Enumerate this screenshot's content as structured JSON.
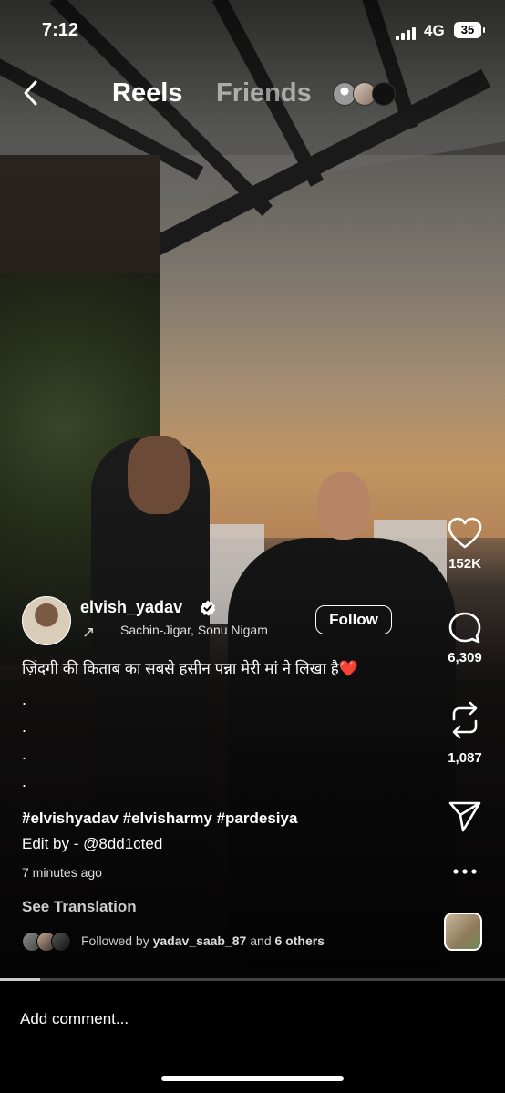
{
  "status_bar": {
    "time": "7:12",
    "network": "4G",
    "battery": "35"
  },
  "header": {
    "back_icon": "chevron-left-icon",
    "tab_reels": "Reels",
    "tab_friends": "Friends"
  },
  "actions": {
    "like_count": "152K",
    "comment_count": "6,309",
    "remix_count": "1,087"
  },
  "post": {
    "username": "elvish_yadav",
    "audio": "Sachin-Jigar, Sonu Nigam",
    "follow_label": "Follow",
    "caption": "ज़िंदगी की किताब का सबसे हसीन पन्ना मेरी मां ने लिखा है❤️",
    "caption_dots": ".\n.\n.\n.\n.",
    "hashtags": "#elvishyadav #elvisharmy #pardesiya",
    "edit_by": "Edit by - @8dd1cted",
    "time_ago": "7 minutes ago",
    "see_translation": "See Translation",
    "followed_prefix": "Followed by",
    "followed_user": "yadav_saab_87",
    "followed_and": "and",
    "followed_others": "6 others"
  },
  "progress": 0.08,
  "comment": {
    "placeholder": "Add comment..."
  }
}
